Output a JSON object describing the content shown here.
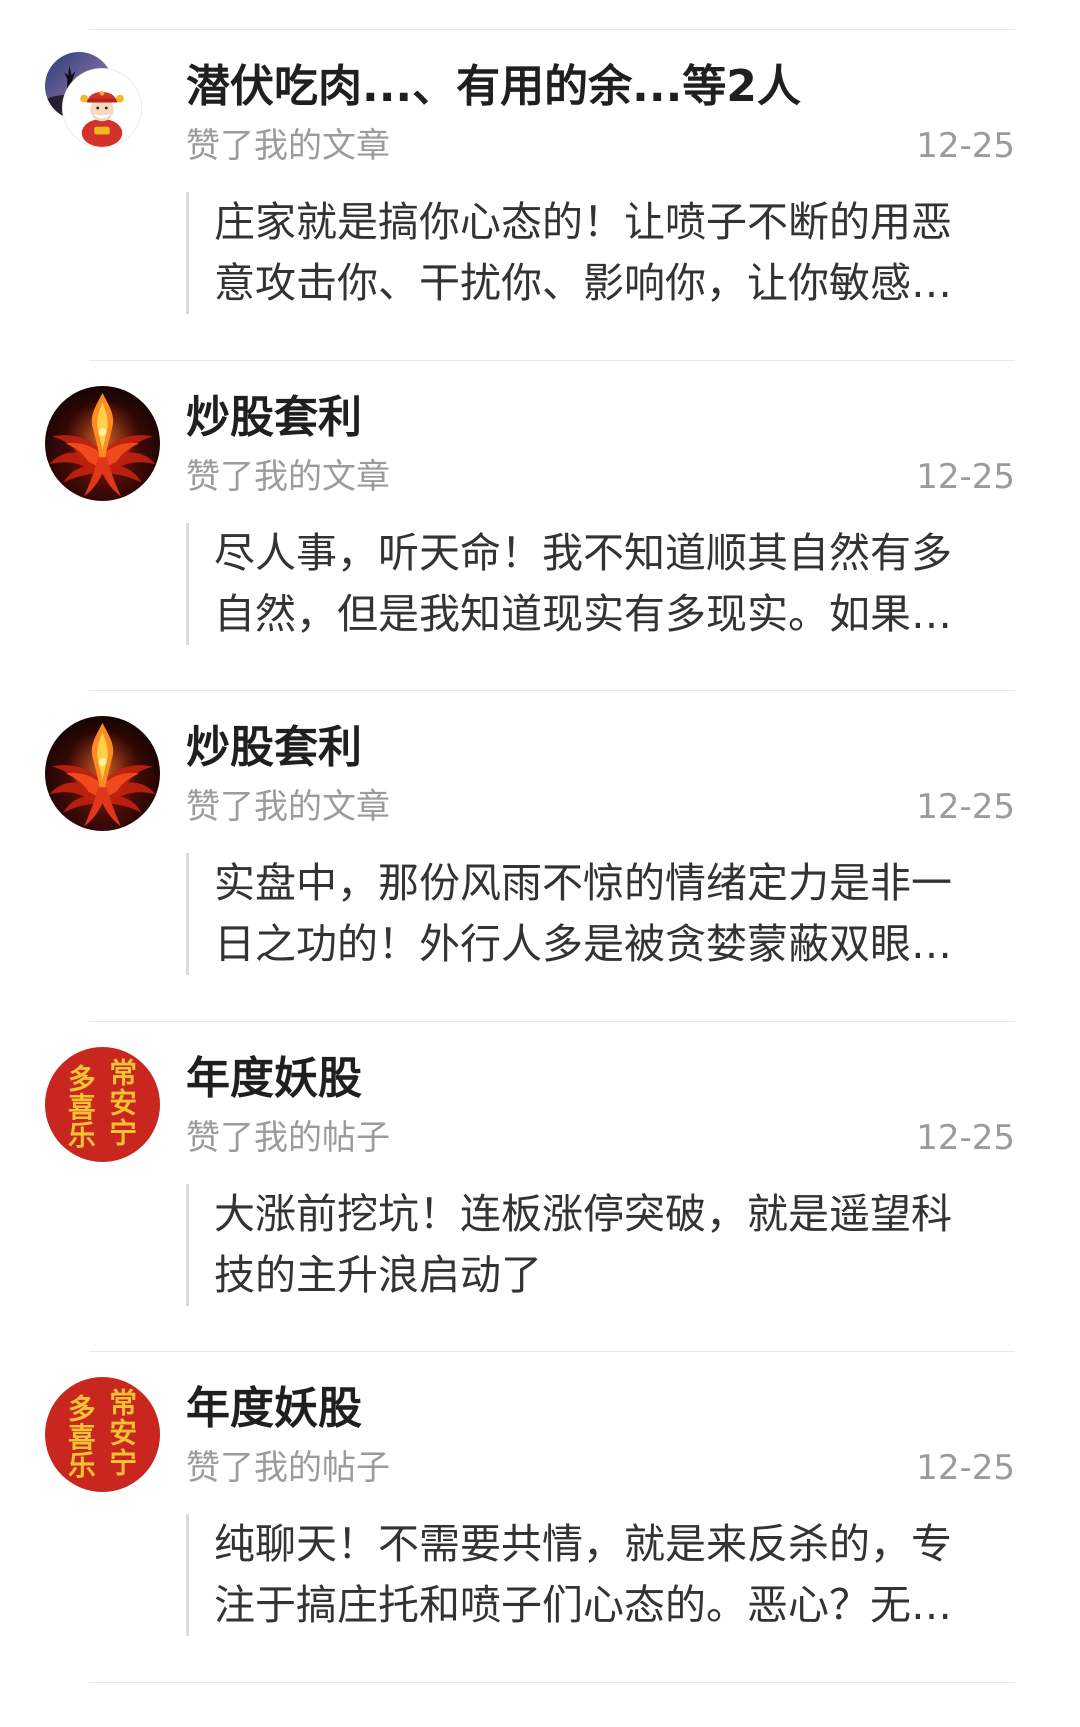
{
  "colors": {
    "name_text": "#1f1f1f",
    "secondary_text": "#9b9b9b",
    "quote_text": "#333333",
    "quote_border": "#dcdcdc",
    "divider": "#e8e8e8",
    "calligraphy_bg": "#c8261f",
    "calligraphy_ink": "#f2c232"
  },
  "feed": {
    "items": [
      {
        "avatar": {
          "icon": "group-avatar"
        },
        "name": "潜伏吃肉...、有用的余...等2人",
        "action": "赞了我的文章",
        "time": "12-25",
        "quote_lines": [
          "庄家就是搞你心态的！让喷子不断的用恶",
          "意攻击你、干扰你、影响你，让你敏感…"
        ]
      },
      {
        "avatar": {
          "icon": "phoenix-avatar"
        },
        "name": "炒股套利",
        "action": "赞了我的文章",
        "time": "12-25",
        "quote_lines": [
          "尽人事，听天命！我不知道顺其自然有多",
          "自然，但是我知道现实有多现实。如果…"
        ]
      },
      {
        "avatar": {
          "icon": "phoenix-avatar"
        },
        "name": "炒股套利",
        "action": "赞了我的文章",
        "time": "12-25",
        "quote_lines": [
          "实盘中，那份风雨不惊的情绪定力是非一",
          "日之功的！外行人多是被贪婪蒙蔽双眼…"
        ]
      },
      {
        "avatar": {
          "icon": "calligraphy-avatar",
          "right_column": [
            "常",
            "安",
            "宁"
          ],
          "left_column": [
            "多",
            "喜",
            "乐"
          ]
        },
        "name": "年度妖股",
        "action": "赞了我的帖子",
        "time": "12-25",
        "quote_lines": [
          "大涨前挖坑！连板涨停突破，就是遥望科",
          "技的主升浪启动了"
        ]
      },
      {
        "avatar": {
          "icon": "calligraphy-avatar",
          "right_column": [
            "常",
            "安",
            "宁"
          ],
          "left_column": [
            "多",
            "喜",
            "乐"
          ]
        },
        "name": "年度妖股",
        "action": "赞了我的帖子",
        "time": "12-25",
        "quote_lines": [
          "纯聊天！不需要共情，就是来反杀的，专",
          "注于搞庄托和喷子们心态的。恶心？无…"
        ]
      }
    ]
  }
}
